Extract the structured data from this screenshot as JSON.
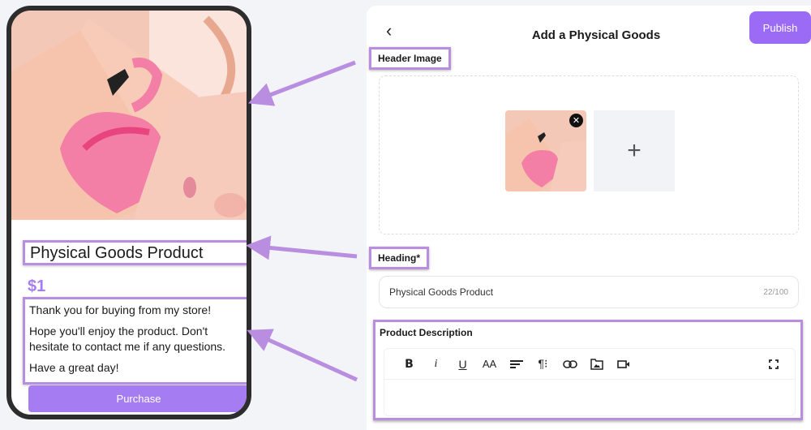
{
  "preview": {
    "title": "Physical Goods Product",
    "price": "$1",
    "description": [
      "Thank you for buying from my store!",
      "Hope you'll enjoy the product. Don't hesitate to contact me if any questions.",
      "Have a great day!"
    ],
    "purchase_label": "Purchase"
  },
  "editor": {
    "back_icon": "‹",
    "title": "Add a Physical Goods",
    "publish_label": "Publish",
    "header_image_label": "Header Image",
    "remove_icon": "✕",
    "add_icon": "+",
    "heading_label": "Heading*",
    "heading_value": "Physical Goods Product",
    "heading_counter": "22/100",
    "description_label": "Product Description",
    "toolbar": {
      "bold": "B",
      "italic": "i",
      "underline": "U",
      "font_size": "AA",
      "align": "≡",
      "paragraph": "¶⁝",
      "link": "⊂⊃",
      "image": "▣",
      "video": "■◂",
      "fullscreen": "⛶"
    }
  },
  "colors": {
    "accent": "#9b6bf6",
    "annotation": "#b98ee0",
    "price": "#a67cf2"
  }
}
